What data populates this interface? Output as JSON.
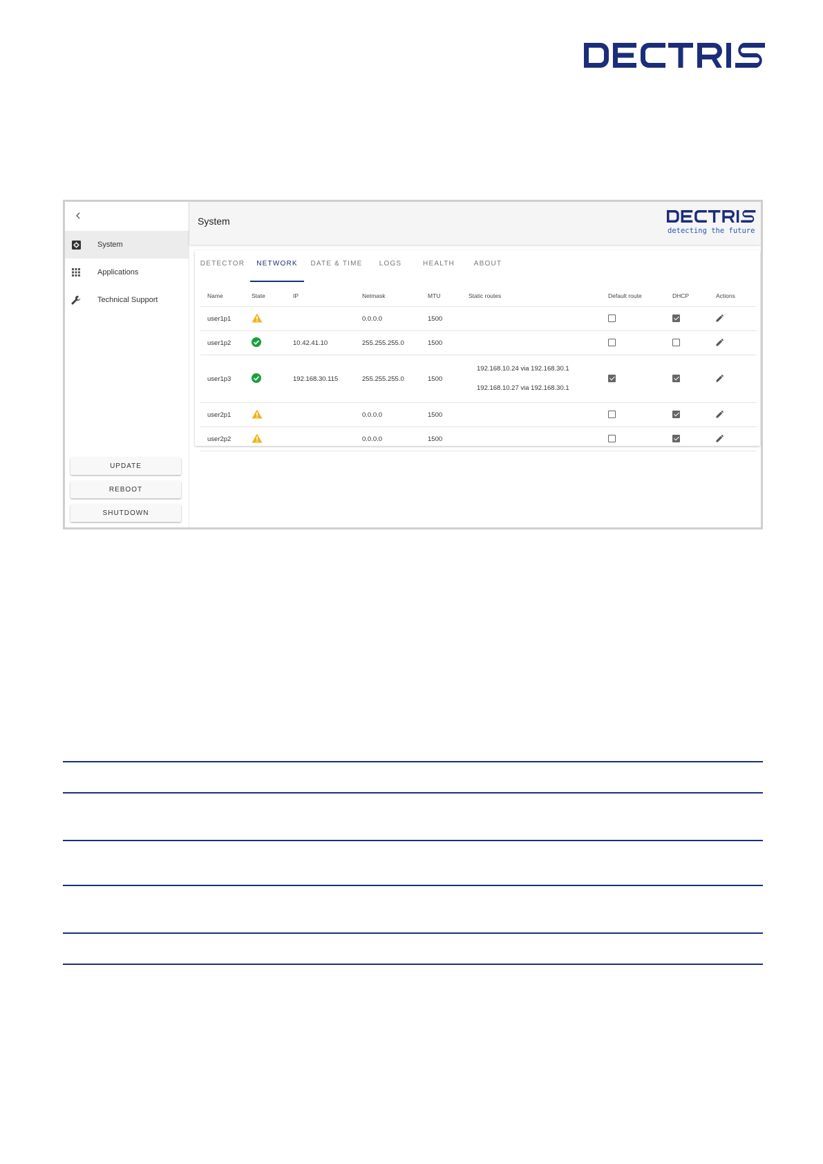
{
  "brand": {
    "name": "DECTRIS",
    "tagline": "detecting the future",
    "color": "#1b2d7a"
  },
  "sidebar": {
    "collapse_icon": "chevron-left-icon",
    "items": [
      {
        "label": "System",
        "icon": "system-settings-icon",
        "active": true
      },
      {
        "label": "Applications",
        "icon": "grid-apps-icon",
        "active": false
      },
      {
        "label": "Technical Support",
        "icon": "wrench-icon",
        "active": false
      }
    ],
    "buttons": {
      "update": "UPDATE",
      "reboot": "REBOOT",
      "shutdown": "SHUTDOWN"
    }
  },
  "header": {
    "title": "System"
  },
  "tabs": [
    {
      "label": "DETECTOR",
      "active": false
    },
    {
      "label": "NETWORK",
      "active": true
    },
    {
      "label": "DATE & TIME",
      "active": false
    },
    {
      "label": "LOGS",
      "active": false
    },
    {
      "label": "HEALTH",
      "active": false
    },
    {
      "label": "ABOUT",
      "active": false
    }
  ],
  "table": {
    "columns": [
      "Name",
      "State",
      "IP",
      "Netmask",
      "MTU",
      "Static routes",
      "Default route",
      "DHCP",
      "Actions"
    ],
    "rows": [
      {
        "name": "user1p1",
        "state": "warning",
        "ip": "",
        "netmask": "0.0.0.0",
        "mtu": "1500",
        "routes": [],
        "default_route": false,
        "dhcp": true
      },
      {
        "name": "user1p2",
        "state": "ok",
        "ip": "10.42.41.10",
        "netmask": "255.255.255.0",
        "mtu": "1500",
        "routes": [],
        "default_route": false,
        "dhcp": false
      },
      {
        "name": "user1p3",
        "state": "ok",
        "ip": "192.168.30.115",
        "netmask": "255.255.255.0",
        "mtu": "1500",
        "routes": [
          "192.168.10.24 via 192.168.30.1",
          "192.168.10.27 via 192.168.30.1"
        ],
        "default_route": true,
        "dhcp": true
      },
      {
        "name": "user2p1",
        "state": "warning",
        "ip": "",
        "netmask": "0.0.0.0",
        "mtu": "1500",
        "routes": [],
        "default_route": false,
        "dhcp": true
      },
      {
        "name": "user2p2",
        "state": "warning",
        "ip": "",
        "netmask": "0.0.0.0",
        "mtu": "1500",
        "routes": [],
        "default_route": false,
        "dhcp": true
      }
    ],
    "status_colors": {
      "ok": "#1e9e3e",
      "warning": "#f1b319"
    },
    "action_icon": "pencil-edit-icon"
  }
}
